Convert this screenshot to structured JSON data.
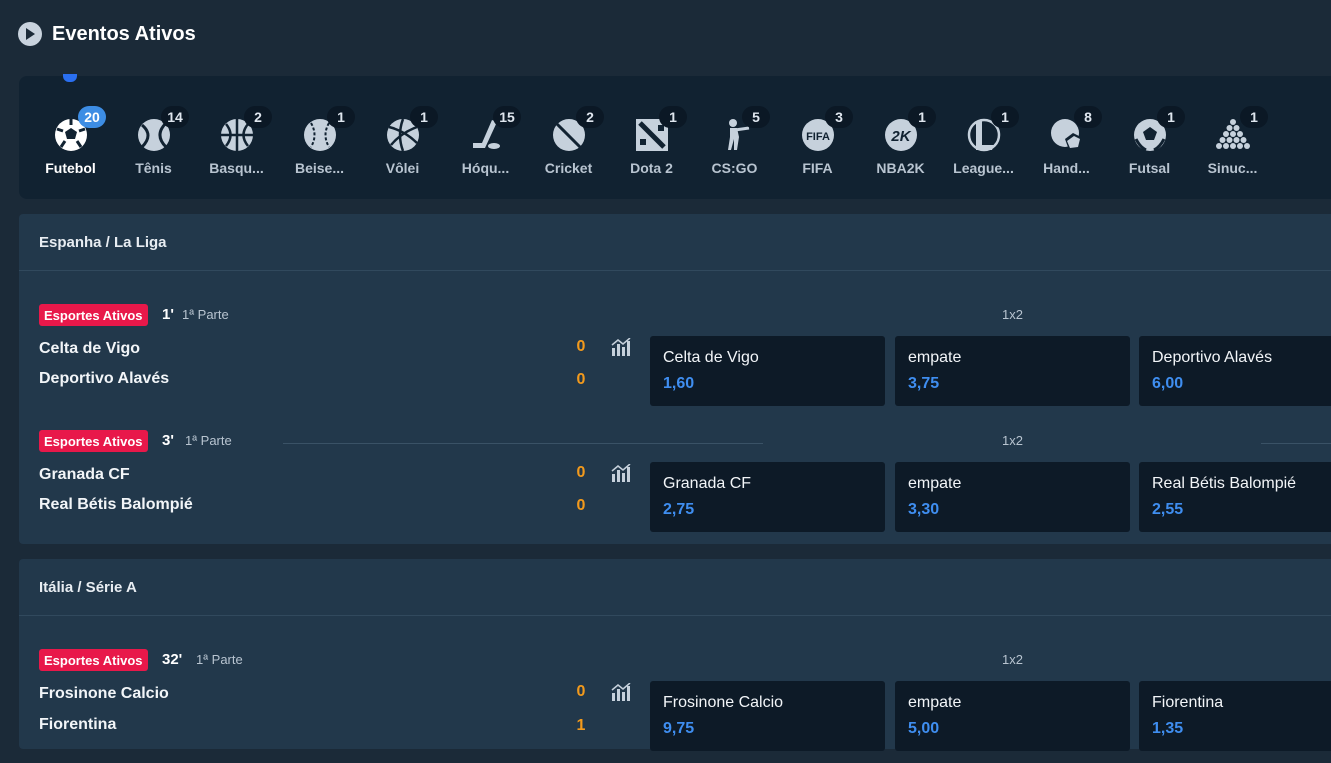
{
  "page": {
    "title": "Eventos Ativos",
    "header_icon": "play-circle-icon"
  },
  "sports": [
    {
      "label": "Futebol",
      "count": "20",
      "icon": "soccer-ball-icon",
      "active": true
    },
    {
      "label": "Tênis",
      "count": "14",
      "icon": "tennis-ball-icon"
    },
    {
      "label": "Basqu...",
      "count": "2",
      "icon": "basketball-icon"
    },
    {
      "label": "Beise...",
      "count": "1",
      "icon": "baseball-icon"
    },
    {
      "label": "Vôlei",
      "count": "1",
      "icon": "volleyball-icon"
    },
    {
      "label": "Hóqu...",
      "count": "15",
      "icon": "hockey-icon"
    },
    {
      "label": "Cricket",
      "count": "2",
      "icon": "cricket-ball-icon"
    },
    {
      "label": "Dota 2",
      "count": "1",
      "icon": "dota2-icon"
    },
    {
      "label": "CS:GO",
      "count": "5",
      "icon": "csgo-icon"
    },
    {
      "label": "FIFA",
      "count": "3",
      "icon": "fifa-icon"
    },
    {
      "label": "NBA2K",
      "count": "1",
      "icon": "nba2k-icon"
    },
    {
      "label": "League...",
      "count": "1",
      "icon": "league-of-legends-icon"
    },
    {
      "label": "Hand...",
      "count": "8",
      "icon": "handball-icon"
    },
    {
      "label": "Futsal",
      "count": "1",
      "icon": "futsal-ball-icon"
    },
    {
      "label": "Sinuc...",
      "count": "1",
      "icon": "snooker-icon"
    }
  ],
  "leagues": [
    {
      "name": "Espanha / La Liga",
      "events": [
        {
          "status": "Esportes Ativos",
          "minute": "1'",
          "period": "1ª Parte",
          "market": "1x2",
          "home": "Celta de Vigo",
          "away": "Deportivo Alavés",
          "home_score": "0",
          "away_score": "0",
          "odds": [
            {
              "name": "Celta de Vigo",
              "value": "1,60"
            },
            {
              "name": "empate",
              "value": "3,75"
            },
            {
              "name": "Deportivo Alavés",
              "value": "6,00"
            }
          ]
        },
        {
          "status": "Esportes Ativos",
          "minute": "3'",
          "period": "1ª Parte",
          "market": "1x2",
          "home": "Granada CF",
          "away": "Real Bétis Balompié",
          "home_score": "0",
          "away_score": "0",
          "odds": [
            {
              "name": "Granada CF",
              "value": "2,75"
            },
            {
              "name": "empate",
              "value": "3,30"
            },
            {
              "name": "Real Bétis Balompié",
              "value": "2,55"
            }
          ]
        }
      ]
    },
    {
      "name": "Itália / Série A",
      "events": [
        {
          "status": "Esportes Ativos",
          "minute": "32'",
          "period": "1ª Parte",
          "market": "1x2",
          "home": "Frosinone Calcio",
          "away": "Fiorentina",
          "home_score": "0",
          "away_score": "1",
          "odds": [
            {
              "name": "Frosinone Calcio",
              "value": "9,75"
            },
            {
              "name": "empate",
              "value": "5,00"
            },
            {
              "name": "Fiorentina",
              "value": "1,35"
            }
          ]
        }
      ]
    }
  ],
  "colors": {
    "live_badge": "#e8184a",
    "score": "#f39a1c",
    "odd_value": "#3f8ef0",
    "active_badge": "#3d8de4"
  }
}
